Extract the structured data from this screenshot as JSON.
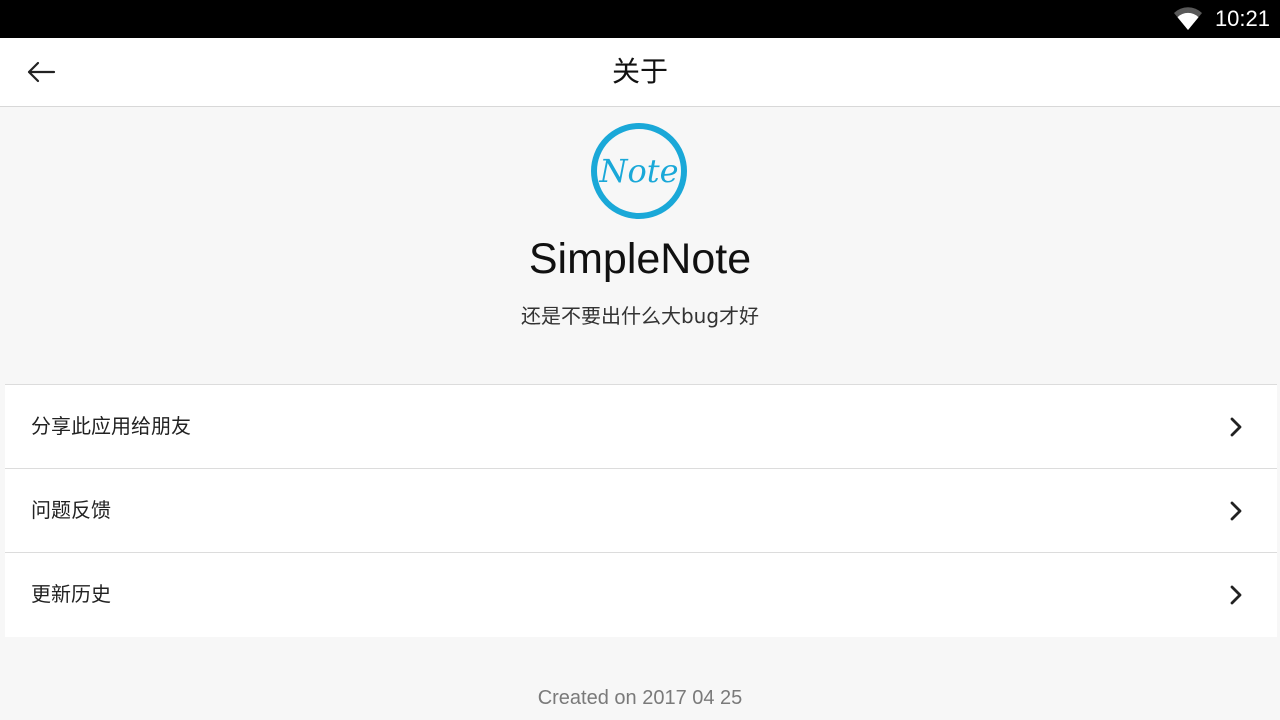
{
  "status_bar": {
    "time": "10:21",
    "icons": [
      "wifi-icon"
    ]
  },
  "app_bar": {
    "back_icon": "arrow-left-icon",
    "title": "关于"
  },
  "hero": {
    "logo_text": "Note",
    "app_name": "SimpleNote",
    "tagline": "还是不要出什么大bug才好",
    "accent_color": "#1aa8d8"
  },
  "menu": {
    "items": [
      {
        "label": "分享此应用给朋友",
        "icon": "chevron-right-icon"
      },
      {
        "label": "问题反馈",
        "icon": "chevron-right-icon"
      },
      {
        "label": "更新历史",
        "icon": "chevron-right-icon"
      }
    ]
  },
  "footer": {
    "created": "Created on 2017 04 25"
  }
}
